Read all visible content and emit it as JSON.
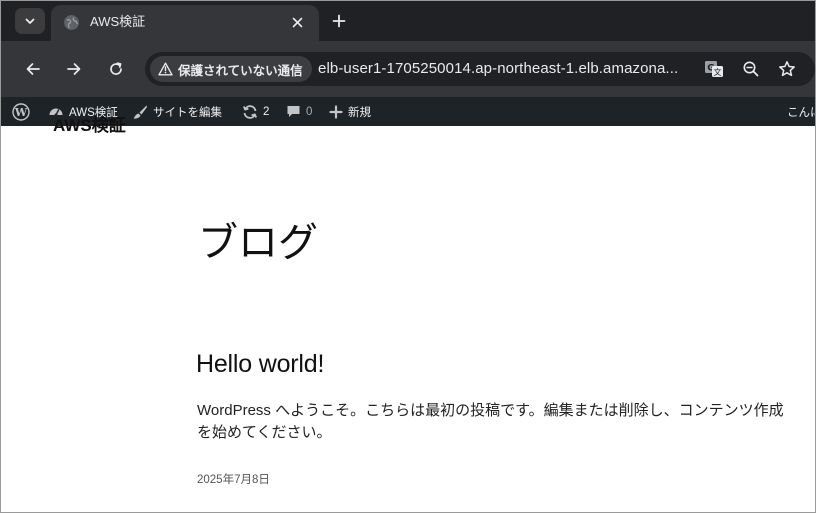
{
  "browser": {
    "tab": {
      "title": "AWS検証",
      "favicon": "globe-icon"
    },
    "toolbar": {
      "security_label": "保護されていない通信",
      "url": "elb-user1-1705250014.ap-northeast-1.elb.amazona..."
    }
  },
  "admin_bar": {
    "site_name": "AWS検証",
    "edit_site": "サイトを編集",
    "updates_count": "2",
    "comments_count": "0",
    "new_label": "新規",
    "greeting": "こんに"
  },
  "page": {
    "site_title": "AWS検証",
    "heading": "ブログ",
    "post": {
      "title": "Hello world!",
      "excerpt": "WordPress へようこそ。こちらは最初の投稿です。編集または削除し、コンテンツ作成を始めてください。",
      "date": "2025年7月8日"
    }
  },
  "colors": {
    "tabstrip_bg": "#202124",
    "toolbar_bg": "#35363a",
    "adminbar_bg": "#1d2327",
    "text_light": "#e8eaed"
  }
}
